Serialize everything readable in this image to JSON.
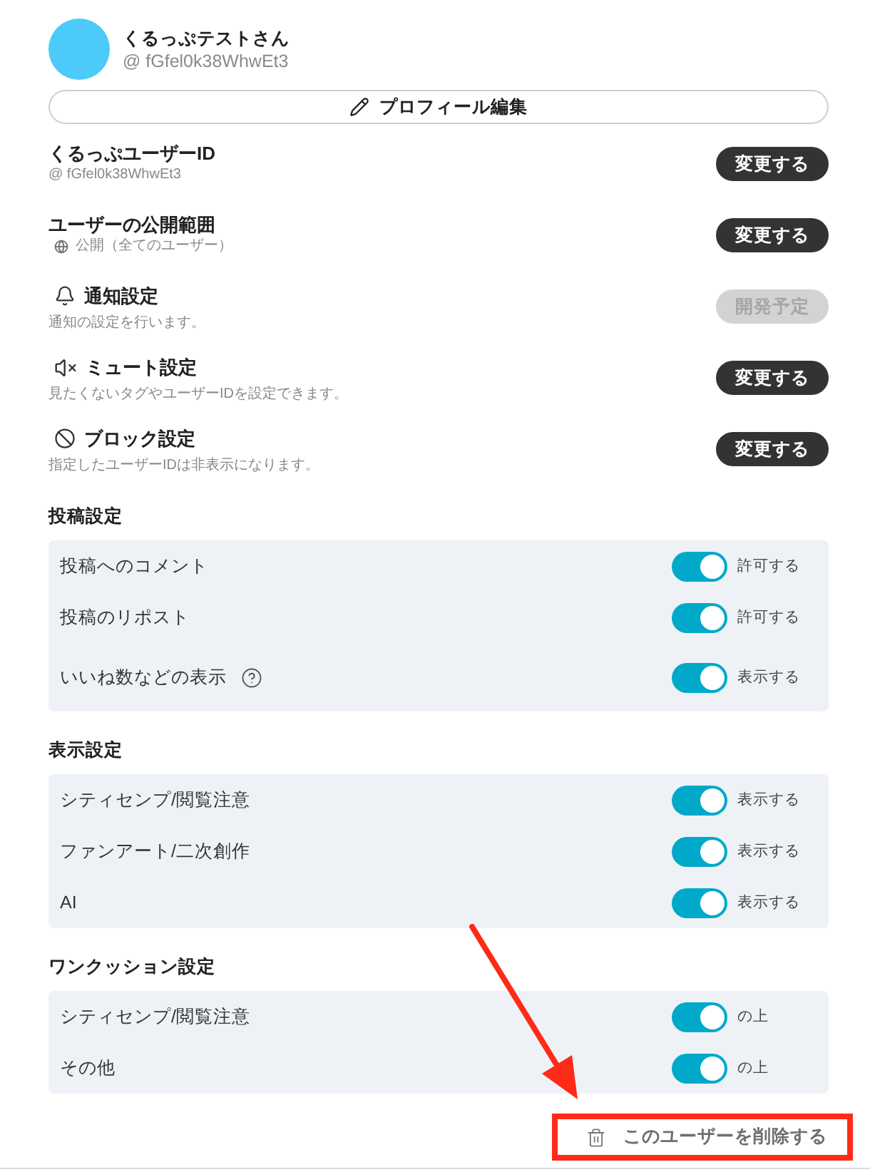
{
  "profile": {
    "name": "くるっぷテストさん",
    "handle": "@ fGfel0k38WhwEt3",
    "edit_button": "プロフィール編集"
  },
  "settings": [
    {
      "kind": "id",
      "title": "くるっぷユーザーID",
      "description": "@ fGfel0k38WhwEt3",
      "button": {
        "label": "変更する",
        "disabled": false
      }
    },
    {
      "kind": "visibility",
      "title": "ユーザーの公開範囲",
      "description": "公開（全てのユーザー）",
      "button": {
        "label": "変更する",
        "disabled": false
      }
    },
    {
      "kind": "notifications",
      "title": "通知設定",
      "description": "通知の設定を行います。",
      "button": {
        "label": "開発予定",
        "disabled": true
      }
    },
    {
      "kind": "mute",
      "title": "ミュート設定",
      "description": "見たくないタグやユーザーIDを設定できます。",
      "button": {
        "label": "変更する",
        "disabled": false
      }
    },
    {
      "kind": "block",
      "title": "ブロック設定",
      "description": "指定したユーザーIDは非表示になります。",
      "button": {
        "label": "変更する",
        "disabled": false
      }
    }
  ],
  "sections": [
    {
      "title": "投稿設定",
      "rows": [
        {
          "label": "投稿へのコメント",
          "help": false,
          "on": true,
          "status": "許可する"
        },
        {
          "label": "投稿のリポスト",
          "help": false,
          "on": true,
          "status": "許可する"
        },
        {
          "label": "いいね数などの表示",
          "help": true,
          "on": true,
          "status": "表示する"
        }
      ]
    },
    {
      "title": "表示設定",
      "rows": [
        {
          "label": "シティセンプ/閲覧注意",
          "help": false,
          "on": true,
          "status": "表示する"
        },
        {
          "label": "ファンアート/二次創作",
          "help": false,
          "on": true,
          "status": "表示する"
        },
        {
          "label": "AI",
          "help": false,
          "on": true,
          "status": "表示する"
        }
      ]
    },
    {
      "title": "ワンクッション設定",
      "rows": [
        {
          "label": "シティセンプ/閲覧注意",
          "help": false,
          "on": true,
          "status": "の上"
        },
        {
          "label": "その他",
          "help": false,
          "on": true,
          "status": "の上"
        }
      ]
    }
  ],
  "delete_button": "このユーザーを削除する"
}
